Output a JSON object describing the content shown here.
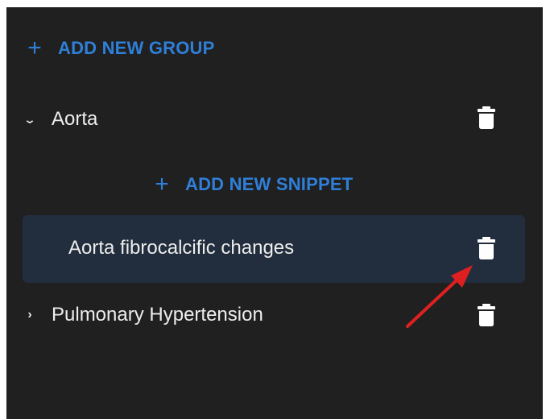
{
  "actions": {
    "add_group_label": "ADD NEW GROUP",
    "add_snippet_label": "ADD NEW SNIPPET"
  },
  "groups": [
    {
      "name": "Aorta",
      "expanded": true,
      "snippets": [
        {
          "name": "Aorta fibrocalcific changes"
        }
      ]
    },
    {
      "name": "Pulmonary Hypertension",
      "expanded": false,
      "snippets": []
    }
  ],
  "icons": {
    "add": "plus-icon",
    "delete": "trash-icon",
    "expanded": "chevron-down-icon",
    "collapsed": "chevron-right-icon",
    "annotation": "red-arrow"
  },
  "colors": {
    "background": "#202020",
    "accent": "#2f7fd8",
    "selected_row": "#222e3d",
    "text": "#ededed",
    "annotation": "#e02020"
  }
}
